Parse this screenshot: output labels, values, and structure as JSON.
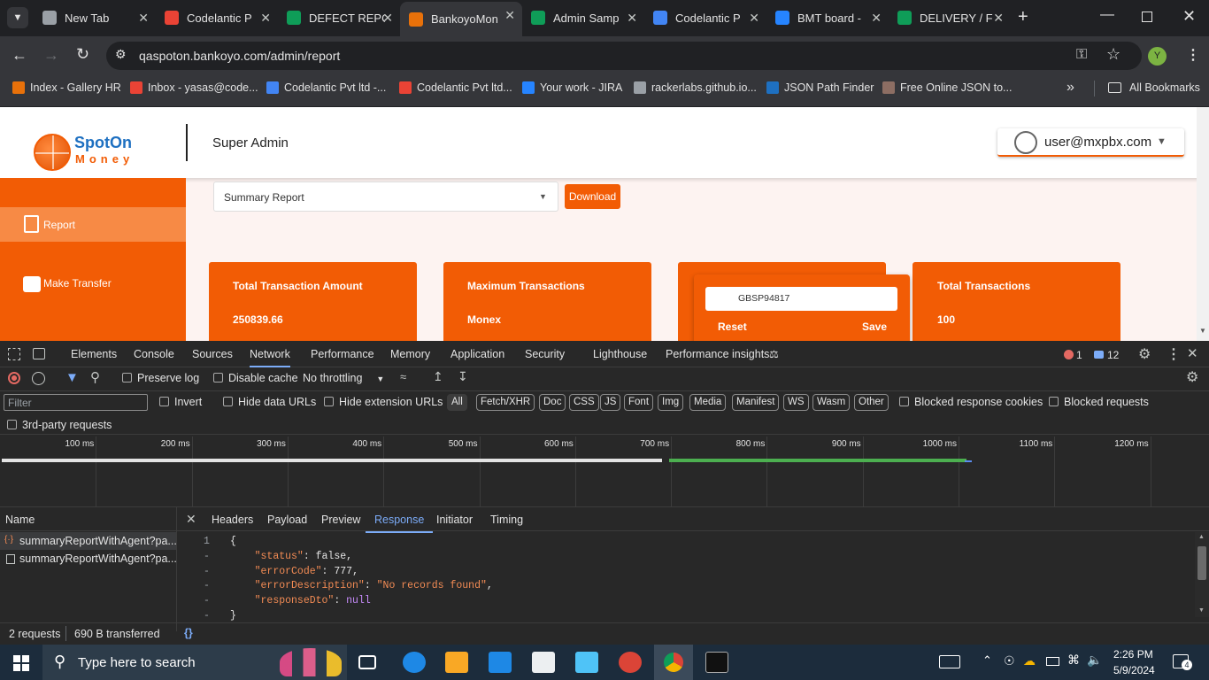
{
  "browser": {
    "tabs": [
      {
        "title": "New Tab",
        "icon": "chrome-icon",
        "color": "#9aa0a6"
      },
      {
        "title": "Codelantic P",
        "icon": "gmail-icon",
        "color": "#ea4335"
      },
      {
        "title": "DEFECT REPO",
        "icon": "sheets-icon",
        "color": "#0f9d58"
      },
      {
        "title": "BankoyoMon",
        "icon": "globe-icon",
        "color": "#e8710a"
      },
      {
        "title": "Admin Samp",
        "icon": "sheets-icon",
        "color": "#0f9d58"
      },
      {
        "title": "Codelantic P",
        "icon": "gdrive-icon",
        "color": "#4285f4"
      },
      {
        "title": "BMT board -",
        "icon": "jira-icon",
        "color": "#2684ff"
      },
      {
        "title": "DELIVERY / F",
        "icon": "sheets-icon",
        "color": "#0f9d58"
      }
    ],
    "url": "qaspoton.bankoyo.com/admin/report",
    "profile_initial": "Y",
    "bookmarks": [
      {
        "label": "Index - Gallery HR"
      },
      {
        "label": "Inbox - yasas@code..."
      },
      {
        "label": "Codelantic Pvt ltd -..."
      },
      {
        "label": "Codelantic Pvt ltd..."
      },
      {
        "label": "Your work - JIRA"
      },
      {
        "label": "rackerlabs.github.io..."
      },
      {
        "label": "JSON Path Finder"
      },
      {
        "label": "Free Online JSON to..."
      }
    ],
    "all_bookmarks": "All Bookmarks"
  },
  "app": {
    "logo_top": "SpotOn",
    "logo_bottom": "Money",
    "role": "Super Admin",
    "user": "user@mxpbx.com",
    "accent": "#f25c05",
    "report_select": "Summary Report",
    "download": "Download",
    "sidebar": [
      {
        "label": "Report",
        "icon": "report-icon"
      },
      {
        "label": "Make Transfer",
        "icon": "transfer-icon"
      }
    ],
    "cards": [
      {
        "title": "Total Transaction Amount",
        "value": "250839.66"
      },
      {
        "title": "Maximum Transactions",
        "value": "Monex"
      },
      {
        "title": "",
        "value": ""
      },
      {
        "title": "Total Transactions",
        "value": "100"
      }
    ],
    "popup": {
      "input": "GBSP94817",
      "reset": "Reset",
      "save": "Save"
    }
  },
  "devtools": {
    "tabs": [
      "Elements",
      "Console",
      "Sources",
      "Network",
      "Performance",
      "Memory",
      "Application",
      "Security",
      "Lighthouse",
      "Performance insights"
    ],
    "active_tab": "Network",
    "errors": "1",
    "messages": "12",
    "preserve_log": "Preserve log",
    "disable_cache": "Disable cache",
    "throttling": "No throttling",
    "filter_placeholder": "Filter",
    "invert": "Invert",
    "hide_data_urls": "Hide data URLs",
    "hide_extension_urls": "Hide extension URLs",
    "filter_types": [
      "All",
      "Fetch/XHR",
      "Doc",
      "CSS",
      "JS",
      "Font",
      "Img",
      "Media",
      "Manifest",
      "WS",
      "Wasm",
      "Other"
    ],
    "blocked_cookies": "Blocked response cookies",
    "blocked_requests": "Blocked requests",
    "third_party": "3rd-party requests",
    "timeline_ticks": [
      "100 ms",
      "200 ms",
      "300 ms",
      "400 ms",
      "500 ms",
      "600 ms",
      "700 ms",
      "800 ms",
      "900 ms",
      "1000 ms",
      "1100 ms",
      "1200 ms"
    ],
    "name_header": "Name",
    "requests": [
      "summaryReportWithAgent?pa...",
      "summaryReportWithAgent?pa..."
    ],
    "detail_tabs": [
      "Headers",
      "Payload",
      "Preview",
      "Response",
      "Initiator",
      "Timing"
    ],
    "active_detail": "Response",
    "response_lines": [
      "{",
      "    \"status\": false,",
      "    \"errorCode\": 777,",
      "    \"errorDescription\": \"No records found\",",
      "    \"responseDto\": null",
      "}"
    ],
    "gutter": [
      "1",
      "-",
      "-",
      "-",
      "-",
      "-"
    ],
    "status_requests": "2 requests",
    "status_transferred": "690 B transferred",
    "pretty_print": "{}"
  },
  "taskbar": {
    "search_placeholder": "Type here to search",
    "time": "2:26 PM",
    "date": "5/9/2024",
    "notifications": "4"
  }
}
